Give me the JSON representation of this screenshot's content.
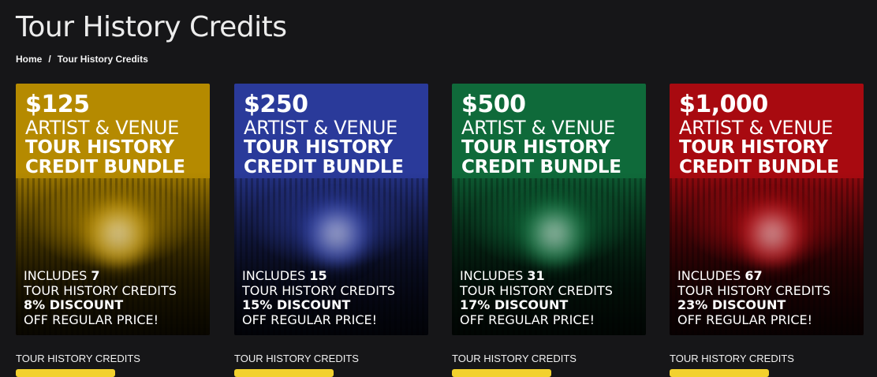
{
  "page": {
    "title": "Tour History Credits",
    "breadcrumb": {
      "home": "Home",
      "separator": "/",
      "current": "Tour History Credits"
    }
  },
  "products": [
    {
      "price": "$125",
      "line1": "ARTIST & VENUE",
      "line2": "TOUR HISTORY",
      "line3": "CREDIT BUNDLE",
      "includes_prefix": "INCLUDES",
      "includes_count": "7",
      "credits_line": "TOUR HISTORY CREDITS",
      "discount": "8% DISCOUNT",
      "regular": "OFF REGULAR PRICE!",
      "label": "TOUR HISTORY CREDITS",
      "color": "#b58a00"
    },
    {
      "price": "$250",
      "line1": "ARTIST & VENUE",
      "line2": "TOUR HISTORY",
      "line3": "CREDIT BUNDLE",
      "includes_prefix": "INCLUDES",
      "includes_count": "15",
      "credits_line": "TOUR HISTORY CREDITS",
      "discount": "15% DISCOUNT",
      "regular": "OFF REGULAR PRICE!",
      "label": "TOUR HISTORY CREDITS",
      "color": "#2a3a9a"
    },
    {
      "price": "$500",
      "line1": "ARTIST & VENUE",
      "line2": "TOUR HISTORY",
      "line3": "CREDIT BUNDLE",
      "includes_prefix": "INCLUDES",
      "includes_count": "31",
      "credits_line": "TOUR HISTORY CREDITS",
      "discount": "17% DISCOUNT",
      "regular": "OFF REGULAR PRICE!",
      "label": "TOUR HISTORY CREDITS",
      "color": "#0f6a3a"
    },
    {
      "price": "$1,000",
      "line1": "ARTIST & VENUE",
      "line2": "TOUR HISTORY",
      "line3": "CREDIT BUNDLE",
      "includes_prefix": "INCLUDES",
      "includes_count": "67",
      "credits_line": "TOUR HISTORY CREDITS",
      "discount": "23% DISCOUNT",
      "regular": "OFF REGULAR PRICE!",
      "label": "TOUR HISTORY CREDITS",
      "color": "#a80a10"
    }
  ]
}
